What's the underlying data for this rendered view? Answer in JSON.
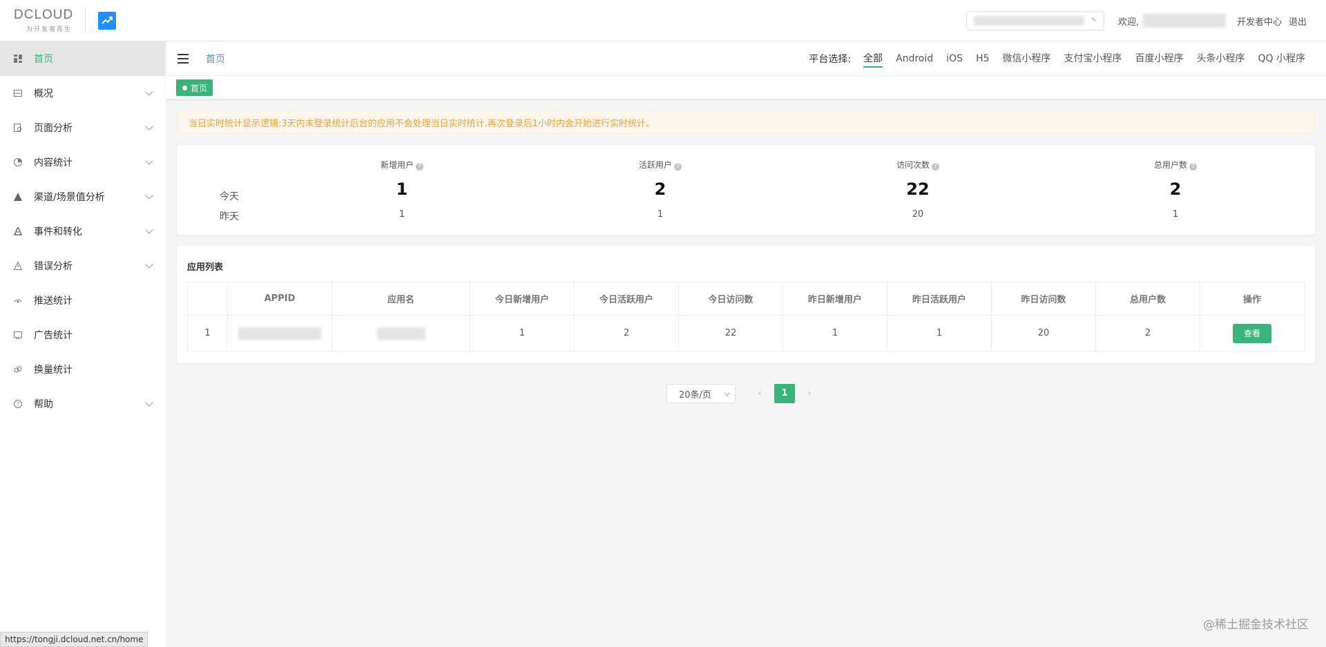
{
  "header": {
    "logo_text": "DCLOUD",
    "logo_sub": "为开发者而生",
    "welcome": "欢迎,",
    "dev_center": "开发者中心",
    "logout": "退出"
  },
  "sidebar": {
    "items": [
      {
        "label": "首页",
        "icon": "dashboard-icon",
        "active": true
      },
      {
        "label": "概况",
        "icon": "overview-icon"
      },
      {
        "label": "页面分析",
        "icon": "page-analysis-icon"
      },
      {
        "label": "内容统计",
        "icon": "pie-icon"
      },
      {
        "label": "渠道/场景值分析",
        "icon": "triangle-icon"
      },
      {
        "label": "事件和转化",
        "icon": "event-icon"
      },
      {
        "label": "错误分析",
        "icon": "warning-icon"
      },
      {
        "label": "推送统计",
        "icon": "push-icon"
      },
      {
        "label": "广告统计",
        "icon": "ad-icon"
      },
      {
        "label": "换量统计",
        "icon": "exchange-icon"
      },
      {
        "label": "帮助",
        "icon": "help-icon"
      }
    ]
  },
  "subheader": {
    "breadcrumb": "首页",
    "platform_label": "平台选择:",
    "platforms": [
      "全部",
      "Android",
      "iOS",
      "H5",
      "微信小程序",
      "支付宝小程序",
      "百度小程序",
      "头条小程序",
      "QQ 小程序"
    ],
    "active_platform": "全部"
  },
  "tags": {
    "home": "首页"
  },
  "notice": "当日实时统计显示逻辑:3天内未登录统计后台的应用不会处理当日实时统计,再次登录后1小时内会开始进行实时统计。",
  "overview": {
    "row_today": "今天",
    "row_yesterday": "昨天",
    "metrics": [
      {
        "title": "新增用户",
        "today": "1",
        "yesterday": "1"
      },
      {
        "title": "活跃用户",
        "today": "2",
        "yesterday": "1"
      },
      {
        "title": "访问次数",
        "today": "22",
        "yesterday": "20"
      },
      {
        "title": "总用户数",
        "today": "2",
        "yesterday": "1"
      }
    ]
  },
  "app_list": {
    "title": "应用列表",
    "columns": [
      "",
      "APPID",
      "应用名",
      "今日新增用户",
      "今日活跃用户",
      "今日访问数",
      "昨日新增用户",
      "昨日活跃用户",
      "昨日访问数",
      "总用户数",
      "操作"
    ],
    "rows": [
      {
        "index": "1",
        "today_new": "1",
        "today_active": "2",
        "today_visits": "22",
        "yest_new": "1",
        "yest_active": "1",
        "yest_visits": "20",
        "total": "2",
        "action": "查看"
      }
    ]
  },
  "pagination": {
    "page_size": "20条/页",
    "current_page": "1"
  },
  "status_url": "https://tongji.dcloud.net.cn/home",
  "watermark": "@稀土掘金技术社区",
  "colors": {
    "accent": "#3ab37d",
    "notice_text": "#e6a23c",
    "notice_bg": "#fdf6ec",
    "breadcrumb": "#6a8bad"
  }
}
